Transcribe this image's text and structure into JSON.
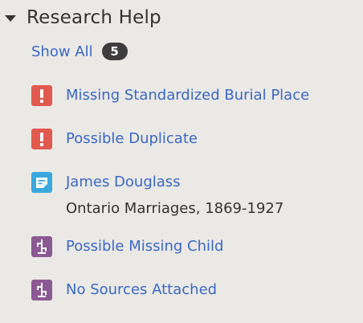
{
  "panel": {
    "title": "Research Help",
    "show_all_label": "Show All",
    "count": "5"
  },
  "items": [
    {
      "icon": "exclamation-icon",
      "color": "#e15a4f",
      "label": "Missing Standardized Burial Place"
    },
    {
      "icon": "exclamation-icon",
      "color": "#e15a4f",
      "label": "Possible Duplicate"
    },
    {
      "icon": "record-hint-icon",
      "color": "#3aa8df",
      "label": "James Douglass",
      "sub": "Ontario Marriages, 1869-1927"
    },
    {
      "icon": "family-tree-icon",
      "color": "#8c5a93",
      "label": "Possible Missing Child"
    },
    {
      "icon": "family-tree-icon",
      "color": "#8c5a93",
      "label": "No Sources Attached"
    }
  ]
}
